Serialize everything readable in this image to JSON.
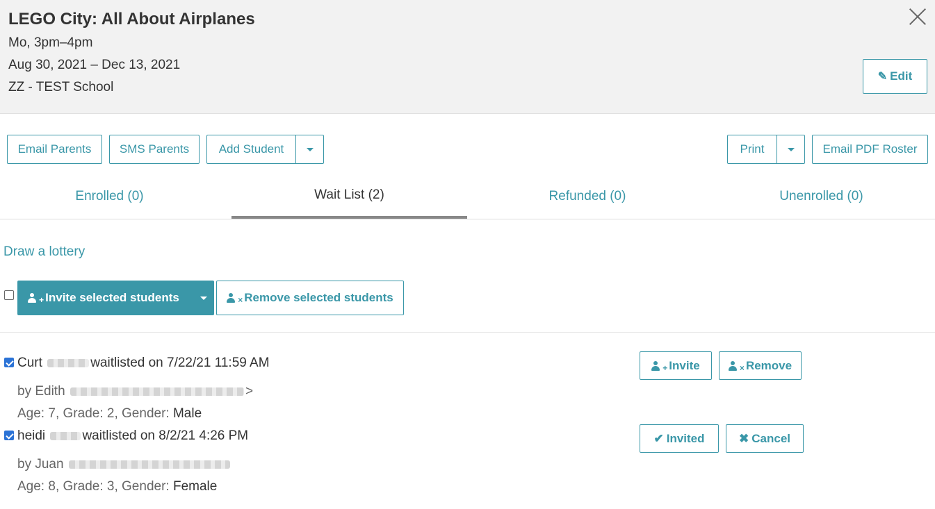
{
  "header": {
    "title": "LEGO City: All About Airplanes",
    "schedule": "Mo, 3pm–4pm",
    "dates": "Aug 30, 2021 – Dec 13, 2021",
    "school": "ZZ - TEST School",
    "edit_label": "Edit"
  },
  "toolbar": {
    "email_parents": "Email Parents",
    "sms_parents": "SMS Parents",
    "add_student": "Add Student",
    "print": "Print",
    "email_pdf_roster": "Email PDF Roster"
  },
  "tabs": [
    {
      "label": "Enrolled (0)"
    },
    {
      "label": "Wait List (2)"
    },
    {
      "label": "Refunded (0)"
    },
    {
      "label": "Unenrolled (0)"
    }
  ],
  "waitlist": {
    "draw_lottery": "Draw a lottery",
    "invite_selected": "Invite selected students",
    "remove_selected": "Remove selected students",
    "entries": [
      {
        "first_name": "Curt",
        "status_text": "waitlisted on 7/22/21 11:59 AM",
        "by_label": "by Edith",
        "by_suffix": ">",
        "age_label": "Age:",
        "age": "7",
        "grade_label": "Grade:",
        "grade": "2",
        "gender_label": "Gender:",
        "gender": "Male",
        "action1": "Invite",
        "action2": "Remove"
      },
      {
        "first_name": "heidi",
        "status_text": "waitlisted on 8/2/21 4:26 PM",
        "by_label": "by Juan",
        "age_label": "Age:",
        "age": "8",
        "grade_label": "Grade:",
        "grade": "3",
        "gender_label": "Gender:",
        "gender": "Female",
        "action1": "Invited",
        "action2": "Cancel"
      }
    ]
  },
  "colors": {
    "accent": "#3a97a8",
    "header_bg": "#f2f2f2",
    "checkbox": "#2b73d6"
  },
  "icons": {
    "close": "close-icon",
    "edit": "pencil-icon",
    "invite": "user-plus-icon",
    "remove": "user-times-icon",
    "invited": "check-icon",
    "cancel": "times-icon"
  }
}
